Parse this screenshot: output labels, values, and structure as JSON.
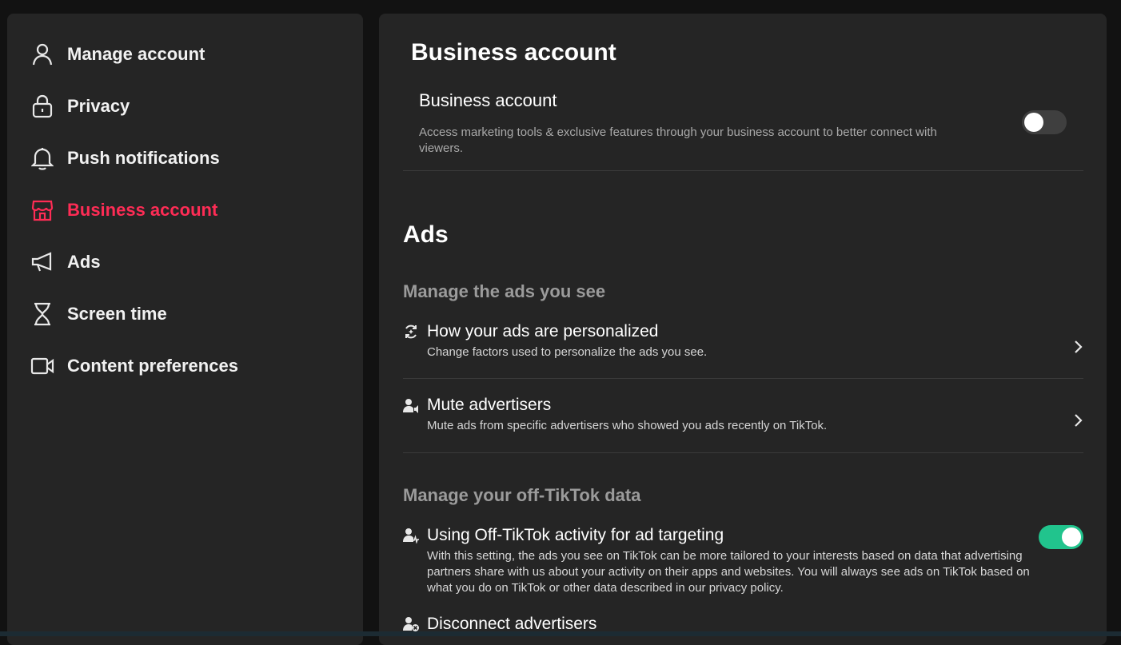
{
  "sidebar": {
    "items": [
      {
        "label": "Manage account",
        "icon": "user-icon"
      },
      {
        "label": "Privacy",
        "icon": "lock-icon"
      },
      {
        "label": "Push notifications",
        "icon": "bell-icon"
      },
      {
        "label": "Business account",
        "icon": "store-icon",
        "active": true
      },
      {
        "label": "Ads",
        "icon": "megaphone-icon"
      },
      {
        "label": "Screen time",
        "icon": "hourglass-icon"
      },
      {
        "label": "Content preferences",
        "icon": "video-camera-icon"
      }
    ]
  },
  "business": {
    "heading": "Business account",
    "setting_title": "Business account",
    "setting_desc": "Access marketing tools & exclusive features through your business account to better connect with viewers.",
    "toggle_state": "off"
  },
  "ads": {
    "heading": "Ads",
    "section1_title": "Manage the ads you see",
    "rows": [
      {
        "title": "How your ads are personalized",
        "desc": "Change factors used to personalize the ads you see.",
        "icon": "personalize-icon"
      },
      {
        "title": "Mute advertisers",
        "desc": "Mute ads from specific advertisers who showed you ads recently on TikTok.",
        "icon": "mute-user-icon"
      }
    ],
    "section2_title": "Manage your off-TikTok data",
    "offtiktok": {
      "title": "Using Off-TikTok activity for ad targeting",
      "desc": "With this setting, the ads you see on TikTok can be more tailored to your interests based on data that advertising partners share with us about your activity on their apps and websites. You will always see ads on TikTok based on what you do on TikTok or other data described in our privacy policy.",
      "toggle_state": "on",
      "icon": "activity-user-icon"
    },
    "disconnect": {
      "title": "Disconnect advertisers",
      "icon": "disconnect-user-icon"
    }
  },
  "colors": {
    "accent": "#fe2c55",
    "toggle_on": "#21c48d",
    "panel": "#252525",
    "background": "#121212"
  }
}
